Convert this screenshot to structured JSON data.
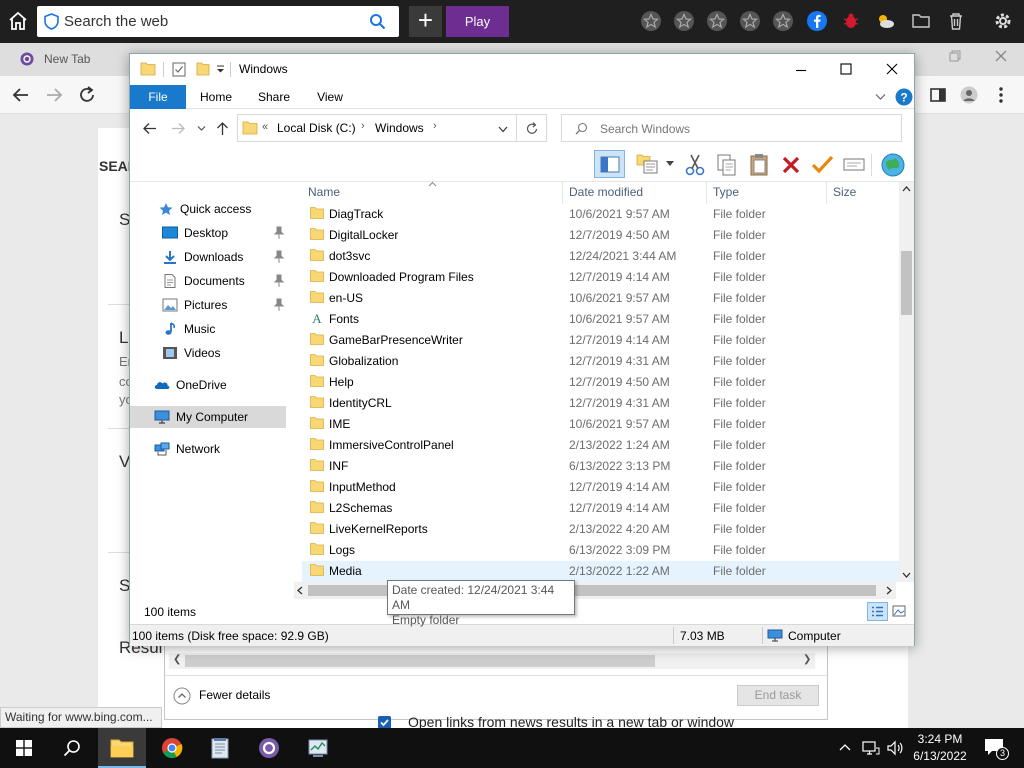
{
  "browser": {
    "search_placeholder": "Search the web",
    "play_label": "Play",
    "tab_label": "New Tab",
    "status_text": "Waiting for www.bing.com...",
    "bg": {
      "sear": "SEAR",
      "s1": "S",
      "l1": "L",
      "l_e": "Er",
      "l_c": "cc",
      "l_y": "yc",
      "v": "V",
      "s2": "S",
      "results": "Resul",
      "checkbox_text": "Open links from news results in a new tab or window"
    }
  },
  "taskmgr": {
    "fewer_details": "Fewer details",
    "end_task": "End task"
  },
  "explorer": {
    "title": "Windows",
    "ribbon_tabs": [
      "File",
      "Home",
      "Share",
      "View"
    ],
    "breadcrumb": [
      "Local Disk (C:)",
      "Windows"
    ],
    "breadcrumb_prefix": "«",
    "search_placeholder": "Search Windows",
    "nav": {
      "quick_access": "Quick access",
      "desktop": "Desktop",
      "downloads": "Downloads",
      "documents": "Documents",
      "pictures": "Pictures",
      "music": "Music",
      "videos": "Videos",
      "onedrive": "OneDrive",
      "my_computer": "My Computer",
      "network": "Network"
    },
    "columns": {
      "name": "Name",
      "date": "Date modified",
      "type": "Type",
      "size": "Size"
    },
    "files": [
      {
        "name": "DiagTrack",
        "date": "10/6/2021 9:57 AM",
        "type": "File folder"
      },
      {
        "name": "DigitalLocker",
        "date": "12/7/2019 4:50 AM",
        "type": "File folder"
      },
      {
        "name": "dot3svc",
        "date": "12/24/2021 3:44 AM",
        "type": "File folder"
      },
      {
        "name": "Downloaded Program Files",
        "date": "12/7/2019 4:14 AM",
        "type": "File folder"
      },
      {
        "name": "en-US",
        "date": "10/6/2021 9:57 AM",
        "type": "File folder"
      },
      {
        "name": "Fonts",
        "date": "10/6/2021 9:57 AM",
        "type": "File folder"
      },
      {
        "name": "GameBarPresenceWriter",
        "date": "12/7/2019 4:14 AM",
        "type": "File folder"
      },
      {
        "name": "Globalization",
        "date": "12/7/2019 4:31 AM",
        "type": "File folder"
      },
      {
        "name": "Help",
        "date": "12/7/2019 4:50 AM",
        "type": "File folder"
      },
      {
        "name": "IdentityCRL",
        "date": "12/7/2019 4:31 AM",
        "type": "File folder"
      },
      {
        "name": "IME",
        "date": "10/6/2021 9:57 AM",
        "type": "File folder"
      },
      {
        "name": "ImmersiveControlPanel",
        "date": "2/13/2022 1:24 AM",
        "type": "File folder"
      },
      {
        "name": "INF",
        "date": "6/13/2022 3:13 PM",
        "type": "File folder"
      },
      {
        "name": "InputMethod",
        "date": "12/7/2019 4:14 AM",
        "type": "File folder"
      },
      {
        "name": "L2Schemas",
        "date": "12/7/2019 4:14 AM",
        "type": "File folder"
      },
      {
        "name": "LiveKernelReports",
        "date": "2/13/2022 4:20 AM",
        "type": "File folder"
      },
      {
        "name": "Logs",
        "date": "6/13/2022 3:09 PM",
        "type": "File folder"
      },
      {
        "name": "Media",
        "date": "2/13/2022 1:22 AM",
        "type": "File folder"
      }
    ],
    "item_count": "100 items",
    "status_left": "100 items (Disk free space: 92.9 GB)",
    "status_size": "7.03 MB",
    "status_location": "Computer",
    "tooltip_line1": "Date created: 12/24/2021 3:44 AM",
    "tooltip_line2": "Empty folder"
  },
  "taskbar": {
    "time": "3:24 PM",
    "date": "6/13/2022",
    "notif_count": "3"
  },
  "colors": {
    "file_tab": "#1979ca",
    "folder": "#f8d775",
    "play": "#6d2d91",
    "selection": "#e5f3ff"
  }
}
